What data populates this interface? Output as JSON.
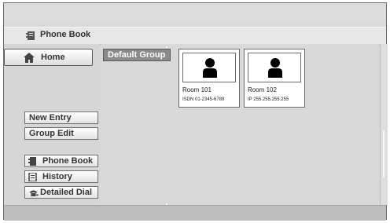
{
  "header": {
    "title": "Phone Book",
    "icon": "phone-book-icon"
  },
  "sidebar": {
    "home_label": "Home",
    "new_entry_label": "New Entry",
    "group_edit_label": "Group Edit",
    "phone_book_label": "Phone Book",
    "history_label": "History",
    "detailed_dial_label": "Detailed Dial"
  },
  "group": {
    "label": "Default Group"
  },
  "entries": [
    {
      "name": "Room 101",
      "address": "ISDN 01-2345-6789"
    },
    {
      "name": "Room 102",
      "address": "IP 255.255.255.255"
    }
  ]
}
